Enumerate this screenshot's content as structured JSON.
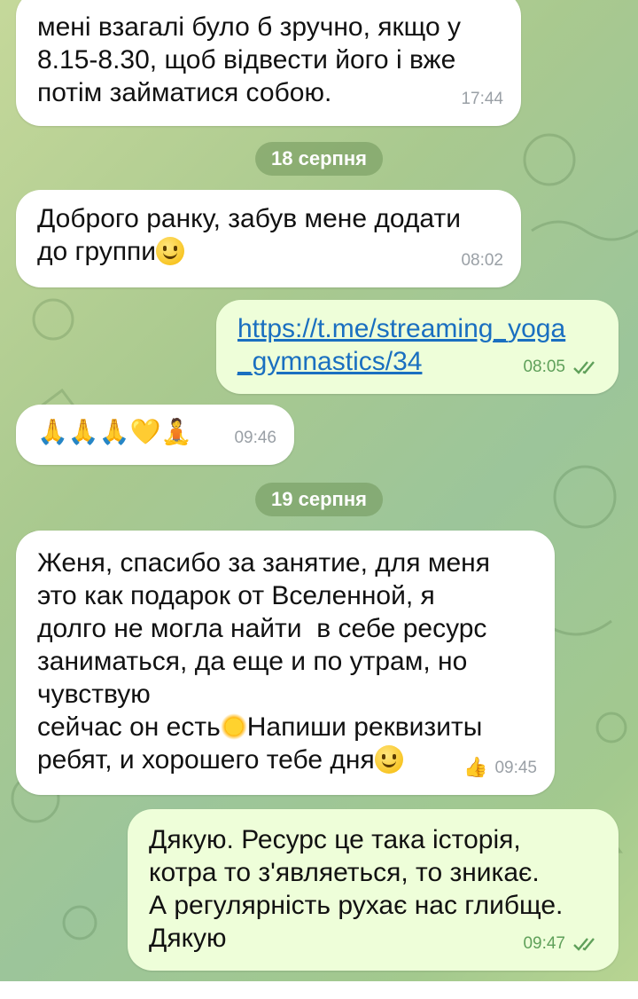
{
  "messages": [
    {
      "id": "m1",
      "direction": "incoming",
      "lines": "мені взагалі було б зручно, якщо у\n8.15-8.30, щоб відвести його і вже\nпотім займатися собою.",
      "time": "17:44"
    },
    {
      "id": "date1",
      "type": "date",
      "label": "18 серпня"
    },
    {
      "id": "m2",
      "direction": "incoming",
      "line1": "Доброго ранку, забув мене додати",
      "line2": "до группи",
      "emoji": "slightly-smiling-face",
      "time": "08:02"
    },
    {
      "id": "m3",
      "direction": "outgoing",
      "link_line1": "https://t.me/streaming_yoga",
      "link_line2": "_gymnastics/34",
      "time": "08:05",
      "status": "read"
    },
    {
      "id": "m4",
      "direction": "incoming",
      "emojis": "🙏🙏🙏💛🧘",
      "time": "09:46"
    },
    {
      "id": "date2",
      "type": "date",
      "label": "19 серпня"
    },
    {
      "id": "m5",
      "direction": "incoming",
      "lines": "Женя, спасибо за занятие, для меня\nэто как подарок от Вселенной, я\nдолго не могла найти  в себе ресурс\nзаниматься, да еще и по утрам, но\nчувствую",
      "line_a": "сейчас он есть",
      "line_a_after": "Напиши реквизиты",
      "line_b": "ребят, и хорошего тебе дня",
      "reaction": "👍",
      "time": "09:45"
    },
    {
      "id": "m6",
      "direction": "outgoing",
      "lines": "Дякую. Ресурс це така історія,\nкотра то з'являеться, то зникає.\nА регулярність рухає нас глибще.\nДякую",
      "time": "09:47",
      "status": "read"
    }
  ],
  "colors": {
    "incoming_bubble": "#ffffff",
    "outgoing_bubble": "#eefed9",
    "link": "#1a6fc0",
    "read_ticks": "#5fa05a",
    "date_pill": "#70965a"
  }
}
